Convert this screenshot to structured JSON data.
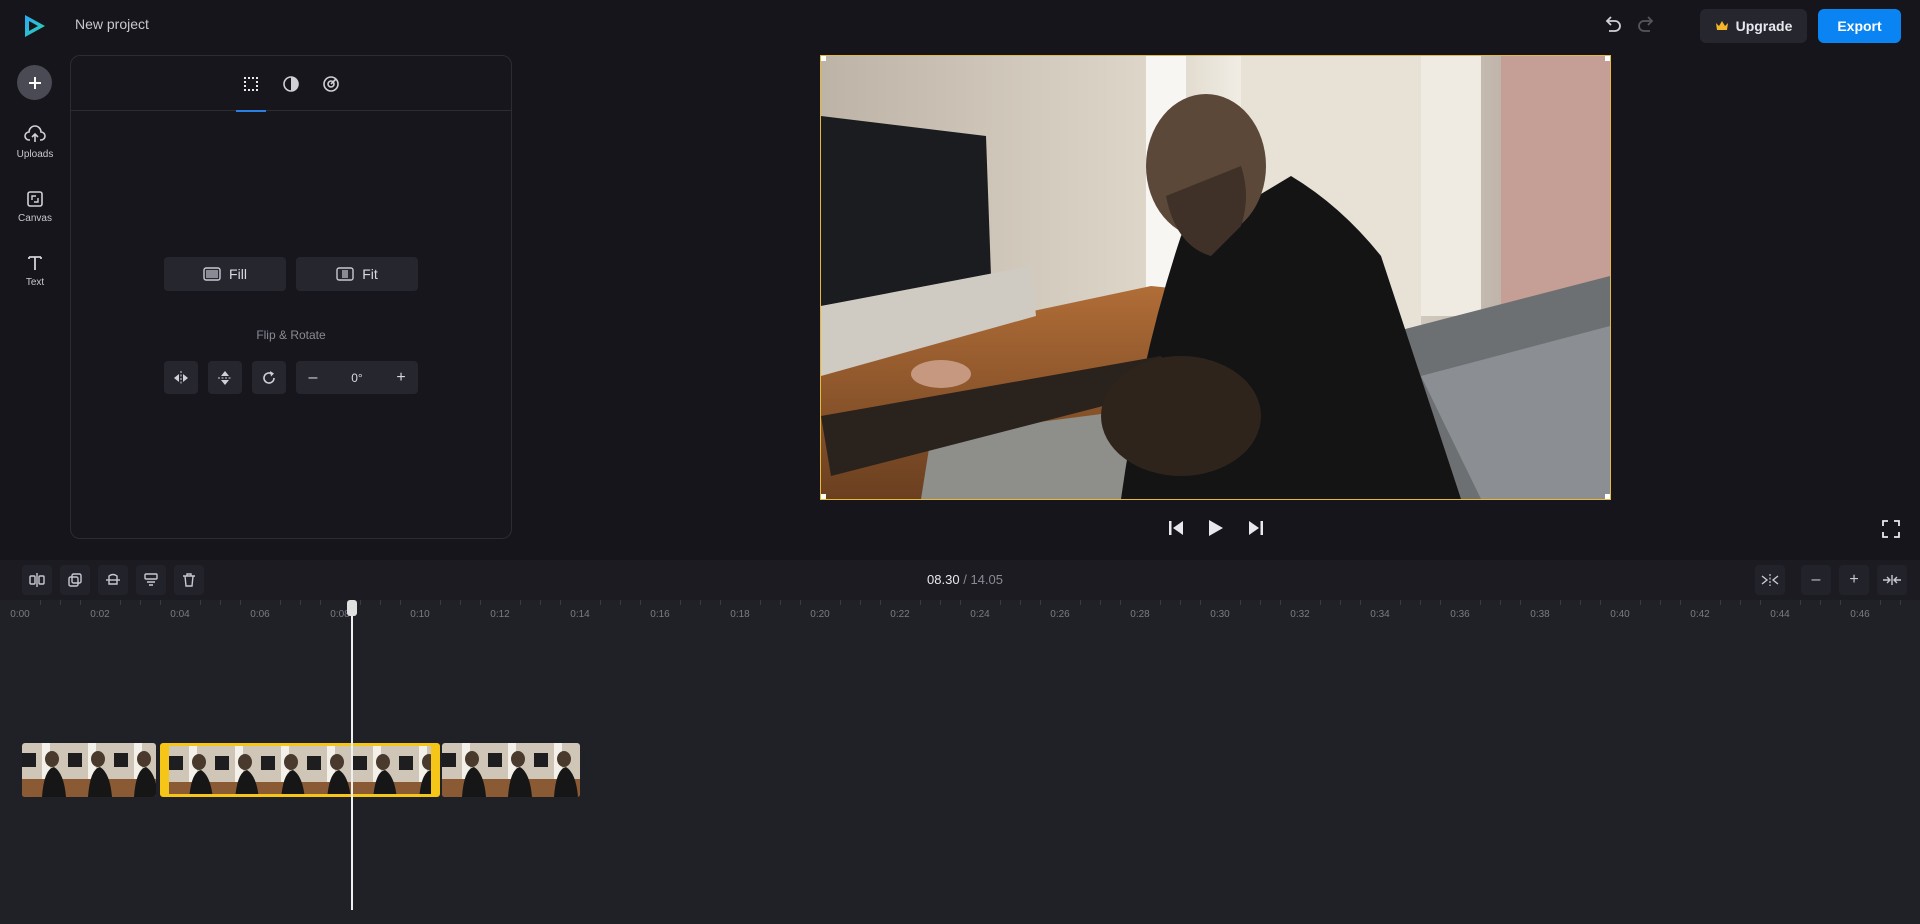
{
  "app": {
    "project_title": "New project",
    "upgrade_label": "Upgrade",
    "export_label": "Export",
    "accent_color": "#0b84f3",
    "selection_color": "#f5c518"
  },
  "sidebar": {
    "items": [
      {
        "label": "Uploads",
        "icon": "upload-cloud-icon"
      },
      {
        "label": "Canvas",
        "icon": "canvas-icon"
      },
      {
        "label": "Text",
        "icon": "text-icon"
      }
    ]
  },
  "panel": {
    "tabs": [
      {
        "icon": "crop-grid-icon",
        "active": true
      },
      {
        "icon": "contrast-icon",
        "active": false
      },
      {
        "icon": "speed-icon",
        "active": false
      }
    ],
    "fill_label": "Fill",
    "fit_label": "Fit",
    "flip_rotate_label": "Flip & Rotate",
    "rotation_value": "0°",
    "rotation_minus": "–",
    "rotation_plus": "+"
  },
  "player": {
    "current_time": "08.30",
    "separator": "/",
    "total_time": "14.05"
  },
  "timeline": {
    "ruler_labels": [
      "0:00",
      "0:02",
      "0:04",
      "0:06",
      "0:08",
      "0:10",
      "0:12",
      "0:14",
      "0:16",
      "0:18",
      "0:20",
      "0:22",
      "0:24",
      "0:26",
      "0:28",
      "0:30",
      "0:32",
      "0:34",
      "0:36",
      "0:38",
      "0:40",
      "0:42",
      "0:44",
      "0:46"
    ],
    "zoom_minus": "–",
    "zoom_plus": "+"
  }
}
